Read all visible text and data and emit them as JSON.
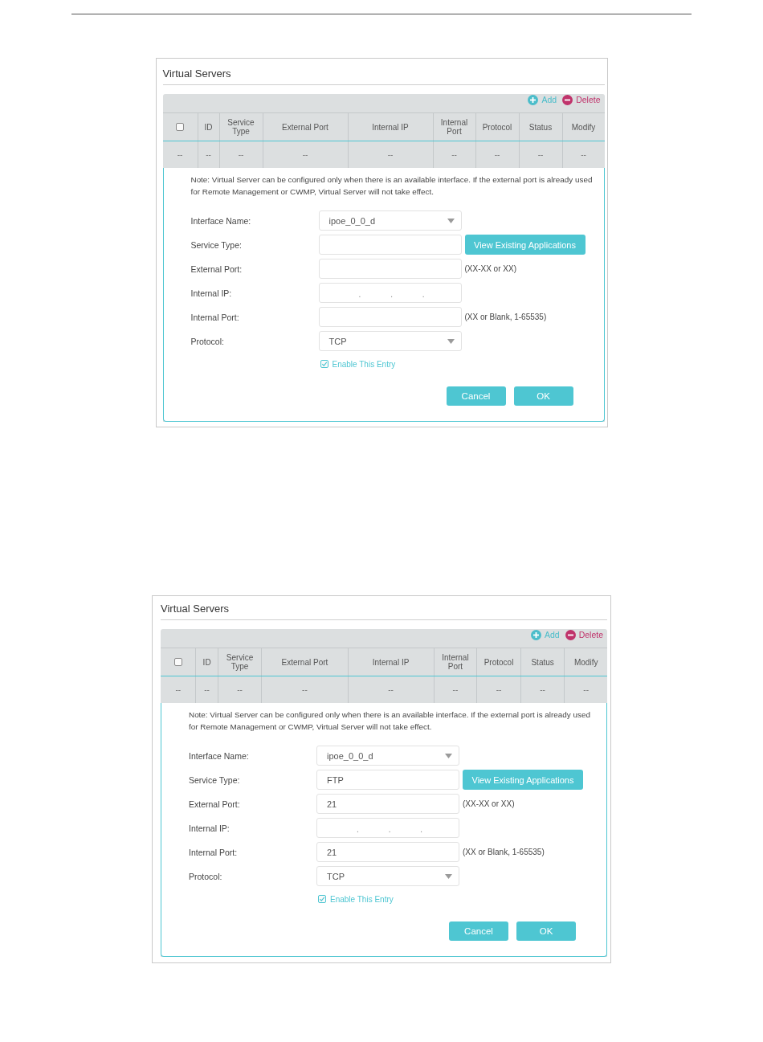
{
  "screenshots": [
    {
      "title": "Virtual Servers",
      "toolbar": [
        {
          "kind": "add",
          "label": "Add",
          "color": "#4bbdca"
        },
        {
          "kind": "delete",
          "label": "Delete",
          "color": "#c0336b"
        }
      ],
      "table": {
        "columns": [
          {
            "kind": "checkbox",
            "checked": false
          },
          {
            "kind": "text",
            "label": "ID"
          },
          {
            "kind": "text",
            "label": "Service Type"
          },
          {
            "kind": "text",
            "label": "External Port"
          },
          {
            "kind": "text",
            "label": "Internal IP"
          },
          {
            "kind": "text",
            "label": "Internal Port"
          },
          {
            "kind": "text",
            "label": "Protocol"
          },
          {
            "kind": "text",
            "label": "Status"
          },
          {
            "kind": "text",
            "label": "Modify"
          }
        ],
        "rows": [
          {
            "cells": [
              "--",
              "--",
              "--",
              "--",
              "--",
              "--",
              "--",
              "--",
              "--"
            ]
          }
        ]
      },
      "note": "Note: Virtual Server can be configured only when there is an available interface. If the external port is already used for Remote Management or CWMP, Virtual Server will not take effect.",
      "form": [
        {
          "kind": "select",
          "label": "Interface Name:",
          "value": "ipoe_0_0_d"
        },
        {
          "kind": "text",
          "label": "Service Type:",
          "button": "View Existing Applications"
        },
        {
          "kind": "text",
          "label": "External Port:",
          "hint": "(XX-XX or XX)"
        },
        {
          "kind": "ip",
          "label": "Internal IP:",
          "separators": [
            ".",
            ".",
            "."
          ]
        },
        {
          "kind": "text",
          "label": "Internal Port:",
          "hint": "(XX or Blank, 1-65535)"
        },
        {
          "kind": "select",
          "label": "Protocol:",
          "value": "TCP"
        }
      ],
      "enable_entry": {
        "label": "Enable This Entry",
        "checked": true
      },
      "buttons": [
        "Cancel",
        "OK"
      ]
    },
    {
      "title": "Virtual Servers",
      "toolbar": [
        {
          "kind": "add",
          "label": "Add",
          "color": "#4bbdca"
        },
        {
          "kind": "delete",
          "label": "Delete",
          "color": "#c0336b"
        }
      ],
      "table": {
        "columns": [
          {
            "kind": "checkbox",
            "checked": false
          },
          {
            "kind": "text",
            "label": "ID"
          },
          {
            "kind": "text",
            "label": "Service Type"
          },
          {
            "kind": "text",
            "label": "External Port"
          },
          {
            "kind": "text",
            "label": "Internal IP"
          },
          {
            "kind": "text",
            "label": "Internal Port"
          },
          {
            "kind": "text",
            "label": "Protocol"
          },
          {
            "kind": "text",
            "label": "Status"
          },
          {
            "kind": "text",
            "label": "Modify"
          }
        ],
        "rows": [
          {
            "cells": [
              "--",
              "--",
              "--",
              "--",
              "--",
              "--",
              "--",
              "--",
              "--"
            ]
          }
        ]
      },
      "note": "Note: Virtual Server can be configured only when there is an available interface. If the external port is already used for Remote Management or CWMP, Virtual Server will not take effect.",
      "form": [
        {
          "kind": "select",
          "label": "Interface Name:",
          "value": "ipoe_0_0_d"
        },
        {
          "kind": "text",
          "label": "Service Type:",
          "value": "FTP",
          "button": "View Existing Applications"
        },
        {
          "kind": "text",
          "label": "External Port:",
          "value": "21",
          "hint": "(XX-XX or XX)"
        },
        {
          "kind": "ip",
          "label": "Internal IP:",
          "separators": [
            ".",
            ".",
            "."
          ]
        },
        {
          "kind": "text",
          "label": "Internal Port:",
          "value": "21",
          "hint": "(XX or Blank, 1-65535)"
        },
        {
          "kind": "select",
          "label": "Protocol:",
          "value": "TCP"
        }
      ],
      "enable_entry": {
        "label": "Enable This Entry",
        "checked": true
      },
      "buttons": [
        "Cancel",
        "OK"
      ]
    }
  ]
}
